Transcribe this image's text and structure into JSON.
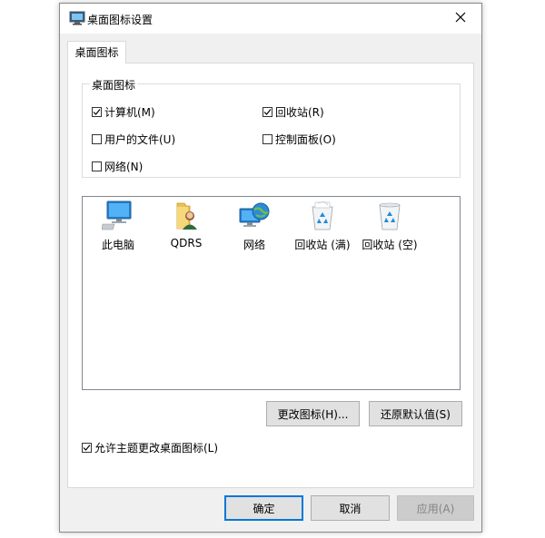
{
  "window": {
    "title": "桌面图标设置",
    "close_glyph": "✕"
  },
  "tab": {
    "label": "桌面图标"
  },
  "group": {
    "title": "桌面图标",
    "checkboxes": [
      {
        "label": "计算机(M)",
        "checked": true
      },
      {
        "label": "回收站(R)",
        "checked": true
      },
      {
        "label": "用户的文件(U)",
        "checked": false
      },
      {
        "label": "控制面板(O)",
        "checked": false
      },
      {
        "label": "网络(N)",
        "checked": false
      }
    ]
  },
  "icons": [
    {
      "label": "此电脑",
      "icon": "computer-icon"
    },
    {
      "label": "QDRS",
      "icon": "user-folder-icon"
    },
    {
      "label": "网络",
      "icon": "network-icon"
    },
    {
      "label": "回收站 (满)",
      "icon": "recycle-bin-full-icon"
    },
    {
      "label": "回收站 (空)",
      "icon": "recycle-bin-empty-icon"
    }
  ],
  "buttons": {
    "change_icon": "更改图标(H)...",
    "restore_default": "还原默认值(S)",
    "ok": "确定",
    "cancel": "取消",
    "apply": "应用(A)"
  },
  "allow_themes": {
    "label": "允许主题更改桌面图标(L)",
    "checked": true
  },
  "colors": {
    "accent": "#0078d7",
    "disabled_text": "#838383"
  }
}
